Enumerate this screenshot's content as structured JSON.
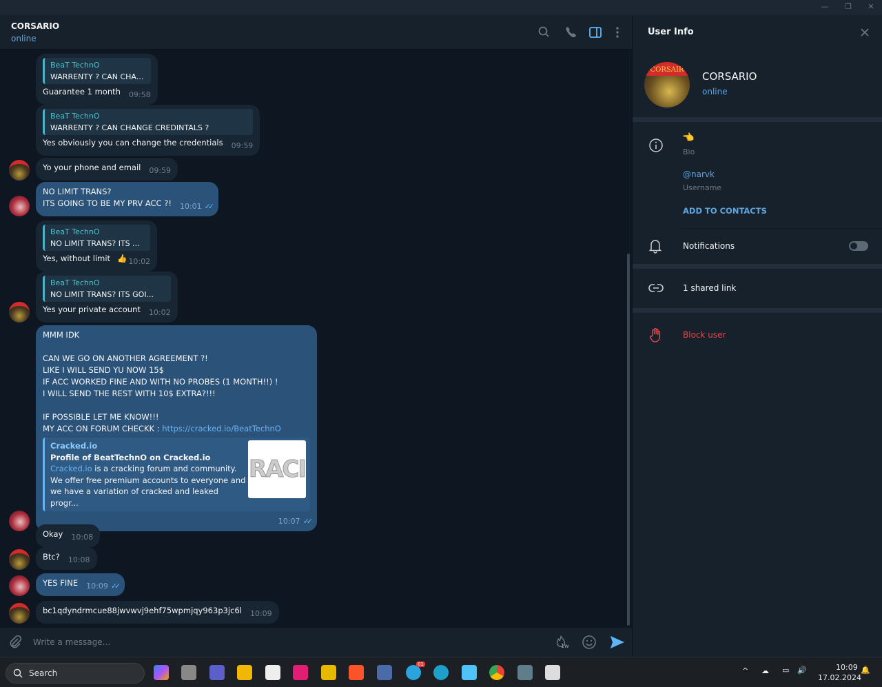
{
  "window": {
    "controls": [
      "minimize",
      "restore",
      "close"
    ]
  },
  "chat_header": {
    "name": "CORSARIO",
    "status": "online",
    "icons": [
      "search-icon",
      "phone-icon",
      "sidebar-toggle-icon",
      "more-vertical-icon"
    ],
    "accent": "#5ea6e0"
  },
  "messages": [
    {
      "dir": "in",
      "reply_name": "BeaT TechnO",
      "reply_text": "WARRENTY ? CAN CHA...",
      "text": "Guarantee 1 month",
      "time": "09:58"
    },
    {
      "dir": "in",
      "reply_name": "BeaT TechnO",
      "reply_text": "WARRENTY ? CAN CHANGE CREDINTALS ?",
      "text": "Yes obviously you can change the credentials",
      "time": "09:59"
    },
    {
      "dir": "in",
      "text": "Yo your phone and email",
      "time": "09:59",
      "avatar": true
    },
    {
      "dir": "out",
      "text": "NO LIMIT TRANS?\nITS GOING TO BE MY PRV ACC ?!",
      "time": "10:01",
      "read": true,
      "avatar": true
    },
    {
      "dir": "in",
      "reply_name": "BeaT TechnO",
      "reply_text": "NO LIMIT TRANS? ITS ...",
      "text": "Yes, without limit",
      "reaction": "👍",
      "time": "10:02"
    },
    {
      "dir": "in",
      "reply_name": "BeaT TechnO",
      "reply_text": "NO LIMIT TRANS? ITS GOI...",
      "text": "Yes your private account",
      "time": "10:02",
      "avatar": true
    },
    {
      "dir": "out",
      "text": "MMM IDK\n\nCAN WE GO ON ANOTHER AGREEMENT ?!\nLIKE I WILL SEND YU NOW 15$\nIF ACC WORKED FINE AND WITH NO PROBES (1 MONTH!!) !\nI WILL SEND THE REST WITH 10$ EXTRA?!!!\n\nIF POSSIBLE LET ME KNOW!!!\nMY ACC ON FORUM CHECKK : ",
      "link": "https://cracked.io/BeatTechnO",
      "preview": {
        "site": "Cracked.io",
        "title": "Profile of BeatTechnO on Cracked.io",
        "desc_link": "Cracked.io",
        "desc": " is a cracking forum and community. We offer free premium accounts to everyone and we have a variation of cracked and leaked progr...",
        "thumb_text": "RACI"
      },
      "time": "10:07",
      "read": true,
      "avatar": true
    },
    {
      "dir": "in",
      "text": "Okay",
      "time": "10:08"
    },
    {
      "dir": "in",
      "text": "Btc?",
      "time": "10:08",
      "avatar": true
    },
    {
      "dir": "out",
      "text": "YES FINE",
      "time": "10:09",
      "read": true,
      "avatar": true
    },
    {
      "dir": "in",
      "text": "bc1qdyndrmcue88jwvwvj9ehf75wpmjqy963p3jc6l",
      "time": "10:09",
      "avatar": true
    }
  ],
  "composer": {
    "placeholder": "Write a message...",
    "timer_badge": "1w"
  },
  "user_info": {
    "title": "User Info",
    "name": "CORSARIO",
    "status": "online",
    "avatar_text": "CORSAIR",
    "bio": "👈",
    "bio_label": "Bio",
    "username": "@narvk",
    "username_label": "Username",
    "add_contacts": "ADD TO CONTACTS",
    "notifications": "Notifications",
    "notifications_on": false,
    "shared_links": "1 shared link",
    "block": "Block user",
    "block_color": "#e5484d"
  },
  "taskbar": {
    "search": "Search",
    "time": "10:09",
    "date": "17.02.2024",
    "telegram_badge": "01"
  }
}
